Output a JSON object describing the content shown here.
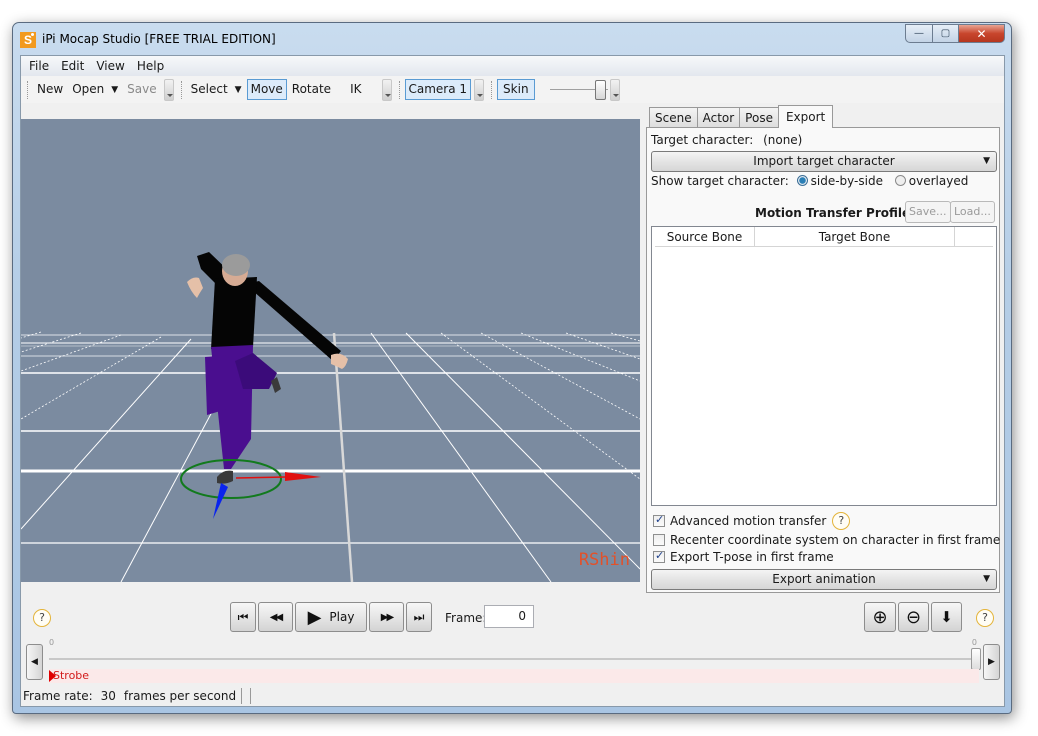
{
  "window": {
    "title": "iPi Mocap Studio [FREE TRIAL EDITION]",
    "app_icon_glyph": "S",
    "controls": {
      "minimize": "—",
      "maximize": "▢",
      "close": "✕"
    }
  },
  "menubar": {
    "items": [
      "File",
      "Edit",
      "View",
      "Help"
    ]
  },
  "toolbar": {
    "new": "New",
    "open": "Open",
    "save": "Save",
    "select": "Select",
    "move": "Move",
    "rotate": "Rotate",
    "ik": "IK",
    "camera": "Camera 1",
    "skin": "Skin",
    "dropdown_arrow": "▼",
    "active_tool": "Move"
  },
  "viewport": {
    "watermark": "RShin",
    "background_color": "#7b8ba0",
    "character": {
      "shirt_color": "#050505",
      "pants_color": "#4a0e8f",
      "hair_color": "#9b9b9b"
    },
    "gizmo": {
      "ring_color": "#127a1d",
      "x_axis_color": "#e01010",
      "z_axis_color": "#0a24ee"
    }
  },
  "side_panel": {
    "tabs": [
      {
        "label": "Scene",
        "selected": false
      },
      {
        "label": "Actor",
        "selected": false
      },
      {
        "label": "Pose",
        "selected": false
      },
      {
        "label": "Export",
        "selected": true
      }
    ],
    "target_character_label": "Target character:",
    "target_character_value": "(none)",
    "import_button": "Import target character",
    "show_target_label": "Show target character:",
    "radio_options": [
      {
        "label": "side-by-side",
        "checked": true
      },
      {
        "label": "overlayed",
        "checked": false
      }
    ],
    "profile_title": "Motion Transfer Profile",
    "profile_save": "Save...",
    "profile_load": "Load...",
    "grid_columns": [
      "Source Bone",
      "Target Bone"
    ],
    "grid_rows": [],
    "checkboxes": [
      {
        "label": "Advanced motion transfer",
        "checked": true,
        "help": true
      },
      {
        "label": "Recenter coordinate system on character in first frame",
        "checked": false,
        "help": false
      },
      {
        "label": "Export T-pose in first frame",
        "checked": true,
        "help": false
      }
    ],
    "export_button": "Export animation",
    "caret": "▼"
  },
  "transport": {
    "help_glyph": "?",
    "first": "⏮",
    "rewind": "◀◀",
    "play_icon": "▶",
    "play_label": "Play",
    "forward": "▶▶",
    "last": "⏭",
    "frame_label": "Frame:",
    "frame_value": "0",
    "zoom_in": "⊕",
    "zoom_out": "⊖",
    "down_arrow": "⬇"
  },
  "timeline": {
    "start_label": "0",
    "end_label": "0",
    "left_arrow": "◀",
    "right_arrow": "▶",
    "track_label": "Strobe",
    "track_color": "#d21a1a"
  },
  "statusbar": {
    "frame_rate_label": "Frame rate:",
    "frame_rate_value": "30",
    "frame_rate_unit": "frames per second"
  }
}
